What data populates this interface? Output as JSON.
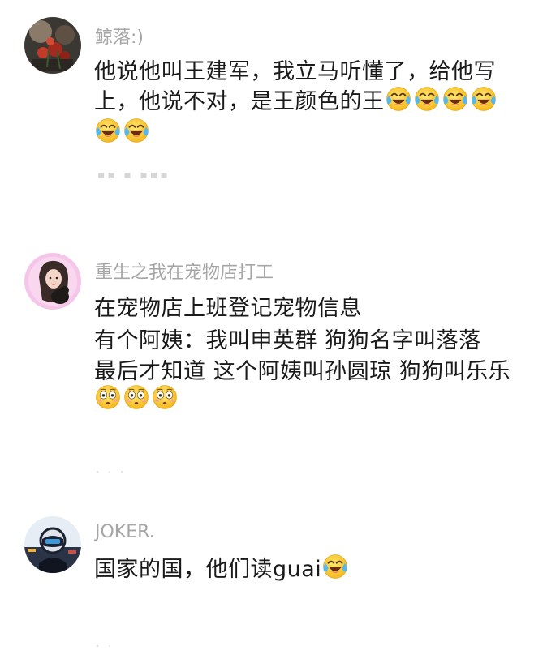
{
  "comments": [
    {
      "username": "鲸落:)",
      "lines": [
        "他说他叫王建军，我立马听懂了，给他写",
        "上，他说不对，是王颜色的王"
      ],
      "reaction_icons": [
        "crying-laughing-icon",
        "crying-laughing-icon",
        "crying-laughing-icon",
        "crying-laughing-icon",
        "crying-laughing-icon",
        "crying-laughing-icon"
      ]
    },
    {
      "username": "重生之我在宠物店打工",
      "lines": [
        "在宠物店上班登记宠物信息",
        "有个阿姨：我叫申英群 狗狗名字叫落落",
        "最后才知道 这个阿姨叫孙圆琼 狗狗叫乐乐"
      ],
      "reaction_icons": [
        "flushed-face-icon",
        "flushed-face-icon",
        "flushed-face-icon"
      ]
    },
    {
      "username": "JOKER.",
      "lines": [
        "国家的国，他们读guai"
      ],
      "reaction_icons": [
        "crying-laughing-icon"
      ]
    }
  ],
  "colors": {
    "username": "#a6a6a6",
    "text": "#1a1a1a",
    "background": "#ffffff",
    "emoji_face": "#fcd23b"
  }
}
